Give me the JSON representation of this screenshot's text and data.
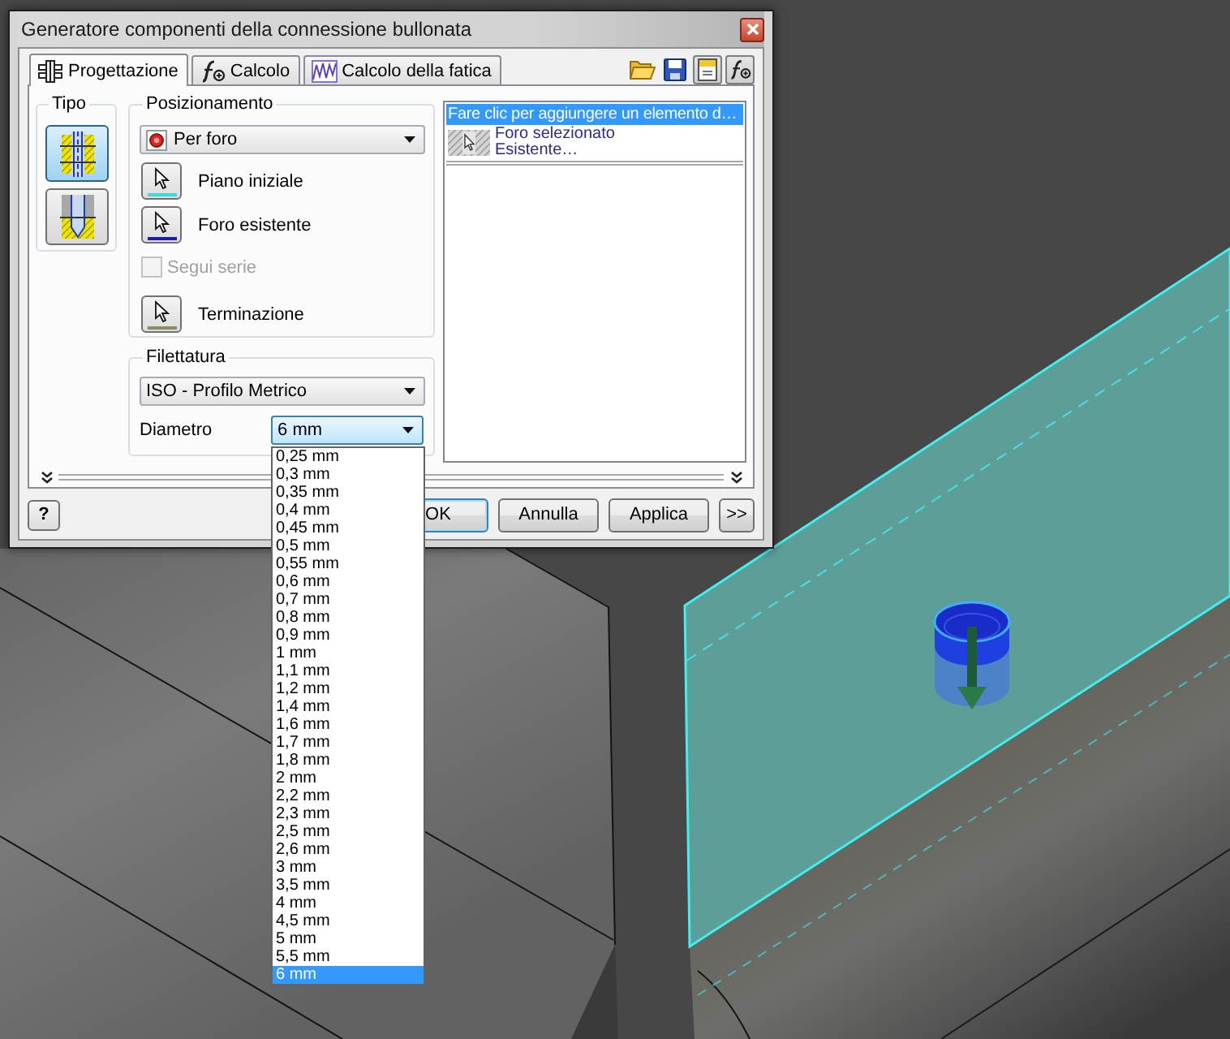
{
  "window": {
    "title": "Generatore componenti della connessione bullonata"
  },
  "tabs": [
    {
      "kind": "design",
      "label": "Progettazione",
      "selected": true
    },
    {
      "kind": "calc",
      "label": "Calcolo",
      "selected": false
    },
    {
      "kind": "fatigue",
      "label": "Calcolo della fatica",
      "selected": false
    }
  ],
  "toolbar": [
    {
      "kind": "open",
      "pressed": false
    },
    {
      "kind": "save",
      "pressed": false
    },
    {
      "kind": "document",
      "pressed": true
    },
    {
      "kind": "formula",
      "pressed": true
    }
  ],
  "tipo": {
    "title": "Tipo",
    "options": [
      {
        "kind": "through",
        "selected": true
      },
      {
        "kind": "blind",
        "selected": false
      }
    ]
  },
  "posizionamento": {
    "title": "Posizionamento",
    "method": "Per foro",
    "items": [
      {
        "kind": "pick",
        "label": "Piano iniziale",
        "color": "#40d8d8"
      },
      {
        "kind": "pick",
        "label": "Foro esistente",
        "color": "#1c1cb4"
      },
      {
        "kind": "checkbox",
        "label": "Segui serie",
        "checked": false,
        "disabled": true
      },
      {
        "kind": "pick",
        "label": "Terminazione",
        "color": "#8c8c64"
      }
    ]
  },
  "filettatura": {
    "title": "Filettatura",
    "thread": "ISO - Profilo Metrico",
    "diameter_label": "Diametro",
    "diameter": "6 mm"
  },
  "elements": [
    {
      "kind": "prompt",
      "text": "Fare clic per aggiungere un elemento d…",
      "selected": true
    },
    {
      "kind": "hole",
      "lines": [
        "Foro selezionato",
        "Esistente…"
      ],
      "selected": false
    }
  ],
  "buttons": {
    "help": "?",
    "actions": [
      {
        "label": "OK",
        "default": true
      },
      {
        "label": "Annulla",
        "default": false
      },
      {
        "label": "Applica",
        "default": false
      },
      {
        "label": ">>",
        "default": false
      }
    ]
  },
  "diameter_list": [
    {
      "label": "0,25 mm",
      "selected": false
    },
    {
      "label": "0,3 mm",
      "selected": false
    },
    {
      "label": "0,35 mm",
      "selected": false
    },
    {
      "label": "0,4 mm",
      "selected": false
    },
    {
      "label": "0,45 mm",
      "selected": false
    },
    {
      "label": "0,5 mm",
      "selected": false
    },
    {
      "label": "0,55 mm",
      "selected": false
    },
    {
      "label": "0,6 mm",
      "selected": false
    },
    {
      "label": "0,7 mm",
      "selected": false
    },
    {
      "label": "0,8 mm",
      "selected": false
    },
    {
      "label": "0,9 mm",
      "selected": false
    },
    {
      "label": "1 mm",
      "selected": false
    },
    {
      "label": "1,1 mm",
      "selected": false
    },
    {
      "label": "1,2 mm",
      "selected": false
    },
    {
      "label": "1,4 mm",
      "selected": false
    },
    {
      "label": "1,6 mm",
      "selected": false
    },
    {
      "label": "1,7 mm",
      "selected": false
    },
    {
      "label": "1,8 mm",
      "selected": false
    },
    {
      "label": "2 mm",
      "selected": false
    },
    {
      "label": "2,2 mm",
      "selected": false
    },
    {
      "label": "2,3 mm",
      "selected": false
    },
    {
      "label": "2,5 mm",
      "selected": false
    },
    {
      "label": "2,6 mm",
      "selected": false
    },
    {
      "label": "3 mm",
      "selected": false
    },
    {
      "label": "3,5 mm",
      "selected": false
    },
    {
      "label": "4 mm",
      "selected": false
    },
    {
      "label": "4,5 mm",
      "selected": false
    },
    {
      "label": "5 mm",
      "selected": false
    },
    {
      "label": "5,5 mm",
      "selected": false
    },
    {
      "label": "6 mm",
      "selected": true
    }
  ]
}
